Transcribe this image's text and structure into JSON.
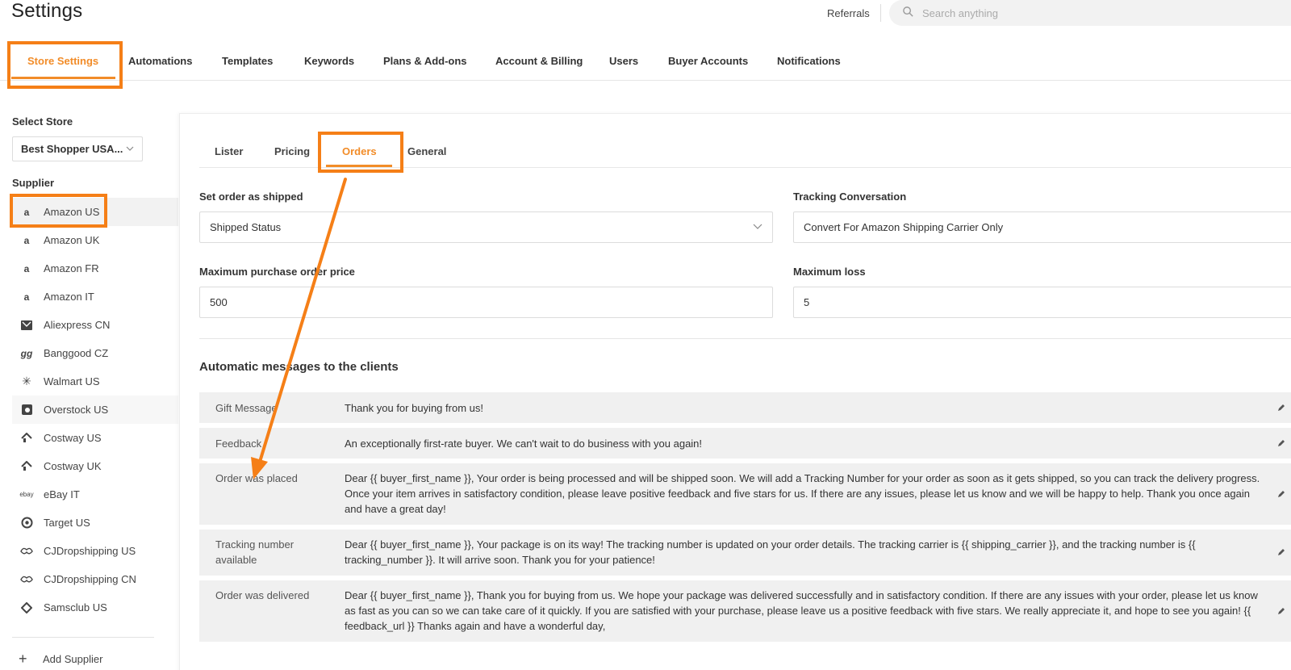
{
  "header": {
    "title": "Settings",
    "referrals": "Referrals",
    "search_placeholder": "Search anything"
  },
  "top_tabs": [
    {
      "label": "Store Settings",
      "active": true
    },
    {
      "label": "Automations"
    },
    {
      "label": "Templates"
    },
    {
      "label": "Keywords"
    },
    {
      "label": "Plans & Add-ons"
    },
    {
      "label": "Account & Billing"
    },
    {
      "label": "Users"
    },
    {
      "label": "Buyer Accounts"
    },
    {
      "label": "Notifications"
    }
  ],
  "sidebar": {
    "select_store_label": "Select Store",
    "selected_store": "Best Shopper USA...",
    "supplier_label": "Supplier",
    "suppliers": [
      {
        "name": "Amazon US",
        "icon": "amazon-icon",
        "selected": true
      },
      {
        "name": "Amazon UK",
        "icon": "amazon-icon"
      },
      {
        "name": "Amazon FR",
        "icon": "amazon-icon"
      },
      {
        "name": "Amazon IT",
        "icon": "amazon-icon"
      },
      {
        "name": "Aliexpress CN",
        "icon": "aliexpress-icon"
      },
      {
        "name": "Banggood CZ",
        "icon": "banggood-icon"
      },
      {
        "name": "Walmart US",
        "icon": "walmart-icon"
      },
      {
        "name": "Overstock US",
        "icon": "overstock-icon"
      },
      {
        "name": "Costway US",
        "icon": "costway-icon"
      },
      {
        "name": "Costway UK",
        "icon": "costway-icon"
      },
      {
        "name": "eBay IT",
        "icon": "ebay-icon"
      },
      {
        "name": "Target US",
        "icon": "target-icon"
      },
      {
        "name": "CJDropshipping US",
        "icon": "cjdropshipping-icon"
      },
      {
        "name": "CJDropshipping CN",
        "icon": "cjdropshipping-icon"
      },
      {
        "name": "Samsclub US",
        "icon": "samsclub-icon"
      }
    ],
    "add_supplier": "Add Supplier"
  },
  "sub_tabs": [
    {
      "label": "Lister"
    },
    {
      "label": "Pricing"
    },
    {
      "label": "Orders",
      "active": true
    },
    {
      "label": "General"
    }
  ],
  "orders": {
    "set_shipped_label": "Set order as shipped",
    "set_shipped_value": "Shipped Status",
    "tracking_conv_label": "Tracking Conversation",
    "tracking_conv_value": "Convert For Amazon Shipping Carrier Only",
    "max_price_label": "Maximum purchase order price",
    "max_price_value": "500",
    "max_loss_label": "Maximum loss",
    "max_loss_value": "5"
  },
  "messages_title": "Automatic messages to the clients",
  "messages": [
    {
      "label": "Gift Message",
      "text": "Thank you for buying from us!"
    },
    {
      "label": "Feedback",
      "text": "An exceptionally first-rate buyer. We can't wait to do business with you again!"
    },
    {
      "label": "Order was placed",
      "text": "Dear {{ buyer_first_name }}, Your order is being processed and will be shipped soon. We will add a Tracking Number for your order as soon as it gets shipped, so you can track the delivery progress. Once your item arrives in satisfactory condition, please leave positive feedback and five stars for us. If there are any issues, please let us know and we will be happy to help. Thank you once again and have a great day!"
    },
    {
      "label": "Tracking number available",
      "text": "Dear {{ buyer_first_name }}, Your package is on its way! The tracking number is updated on your order details. The tracking carrier is {{ shipping_carrier }}, and the tracking number is {{ tracking_number }}. It will arrive soon. Thank you for your patience!"
    },
    {
      "label": "Order was delivered",
      "text": "Dear {{ buyer_first_name }}, Thank you for buying from us. We hope your package was delivered successfully and in satisfactory condition. If there are any issues with your order, please let us know as fast as you can so we can take care of it quickly. If you are satisfied with your purchase, please leave us a positive feedback with five stars. We really appreciate it, and hope to see you again! {{ feedback_url }} Thanks again and have a wonderful day,"
    }
  ],
  "colors": {
    "accent": "#f28c28",
    "highlight": "#f57f17",
    "row_bg": "#f0f0f0"
  }
}
